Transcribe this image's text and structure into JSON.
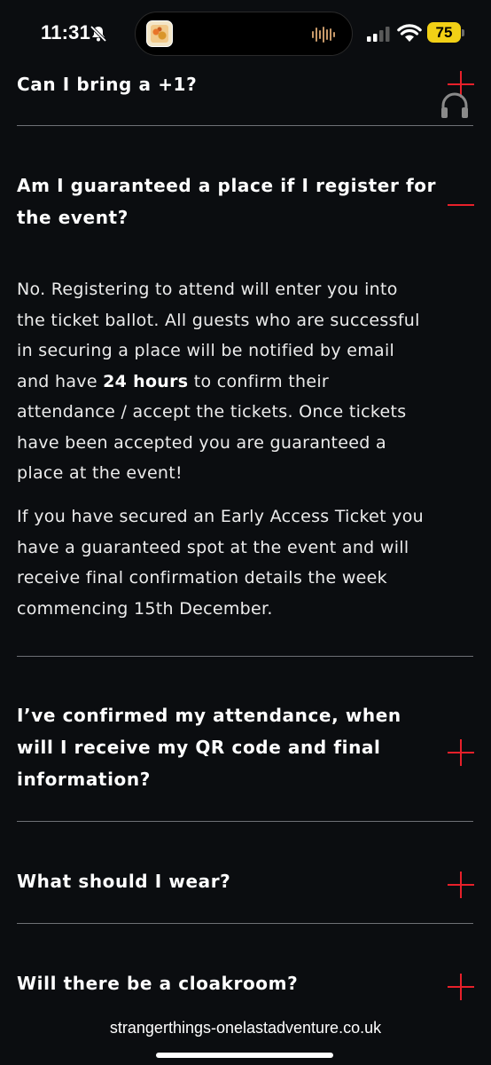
{
  "status_bar": {
    "time": "11:31",
    "battery": "75",
    "battery_color": "#f2d016",
    "icons": [
      "bell-slash-icon",
      "app-artwork-icon",
      "waveform-icon",
      "cellular-signal-icon",
      "wifi-icon",
      "battery-icon"
    ]
  },
  "faq": {
    "accent_color": "#e8202a",
    "items": [
      {
        "question": "Can I bring a +1?",
        "state": "collapsed",
        "toggle": "plus-icon"
      },
      {
        "question_line1": "Am I guaranteed a place if I register for",
        "question_line2": "the event?",
        "state": "expanded",
        "toggle": "minus-icon",
        "answer": {
          "p1_line1": "No. Registering to attend will enter you into",
          "p1_line2": "the ticket ballot. All guests who are successful",
          "p1_line3": "in securing a place will be notified by email",
          "p1_line4_pre": "and have ",
          "p1_line4_bold": "24 hours",
          "p1_line4_post": " to confirm their",
          "p1_line5": "attendance / accept the tickets. Once tickets",
          "p1_line6": "have been accepted you are guaranteed a",
          "p1_line7": "place at the event!",
          "p2_line1": "If you have secured an Early Access Ticket you",
          "p2_line2": "have a guaranteed spot at the event and will",
          "p2_line3": "receive final confirmation details the week",
          "p2_line4": "commencing 15th December."
        }
      },
      {
        "question_line1": "I’ve confirmed my attendance, when",
        "question_line2": "will I receive my QR code and final",
        "question_line3": "information?",
        "state": "collapsed",
        "toggle": "plus-icon"
      },
      {
        "question": "What should I wear?",
        "state": "collapsed",
        "toggle": "plus-icon"
      },
      {
        "question": "Will there be a cloakroom?",
        "state": "collapsed",
        "toggle": "plus-icon"
      }
    ]
  },
  "floating": {
    "icon": "headphones-icon"
  },
  "browser": {
    "url": "strangerthings-onelastadventure.co.uk"
  }
}
